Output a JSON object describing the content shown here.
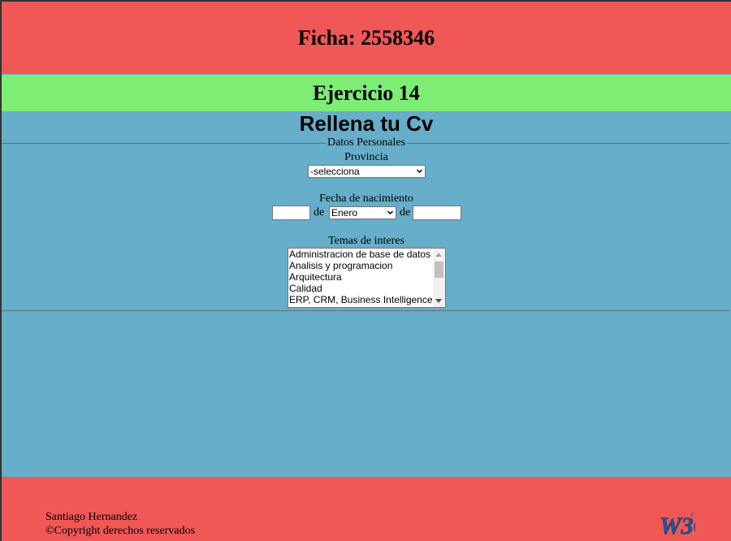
{
  "header": {
    "title": "Ficha: 2558346"
  },
  "subheader": {
    "title": "Ejercicio 14"
  },
  "form": {
    "title": "Rellena tu Cv",
    "legend": "Datos Personales",
    "provincia": {
      "label": "Provincia",
      "value": "-selecciona"
    },
    "fecha": {
      "label": "Fecha de nacimiento",
      "separator1": "de",
      "separator2": "de",
      "month_value": "Enero",
      "day_value": "",
      "year_value": ""
    },
    "temas": {
      "label": "Temas de interes",
      "options": [
        "Administracion de base de datos",
        "Analisis y programacion",
        "Arquitectura",
        "Calidad",
        "ERP, CRM, Business Intelligence"
      ]
    }
  },
  "footer": {
    "author": "Santiago Hernandez",
    "copyright": "©Copyright derechos reservados",
    "badge": "W3C"
  },
  "colors": {
    "header_bg": "#f05757",
    "subheader_bg": "#7ded74",
    "page_bg": "#66aec9",
    "w3c_blue": "#1c5a9e"
  }
}
